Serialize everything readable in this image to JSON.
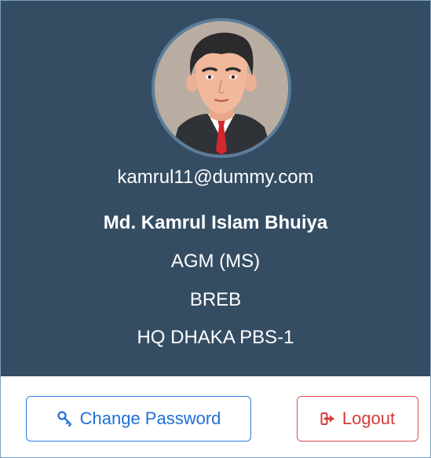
{
  "profile": {
    "avatar_alt": "profile-avatar",
    "email": "kamrul11@dummy.com",
    "name": "Md. Kamrul Islam Bhuiya",
    "designation": "AGM (MS)",
    "organization": "BREB",
    "office": "HQ DHAKA PBS-1"
  },
  "actions": {
    "change_password_label": "Change Password",
    "logout_label": "Logout"
  },
  "colors": {
    "header_bg": "#344d63",
    "primary": "#1f6fd6",
    "danger": "#d43a3a"
  },
  "icons": {
    "change_password": "key-icon",
    "logout": "sign-out-icon"
  }
}
